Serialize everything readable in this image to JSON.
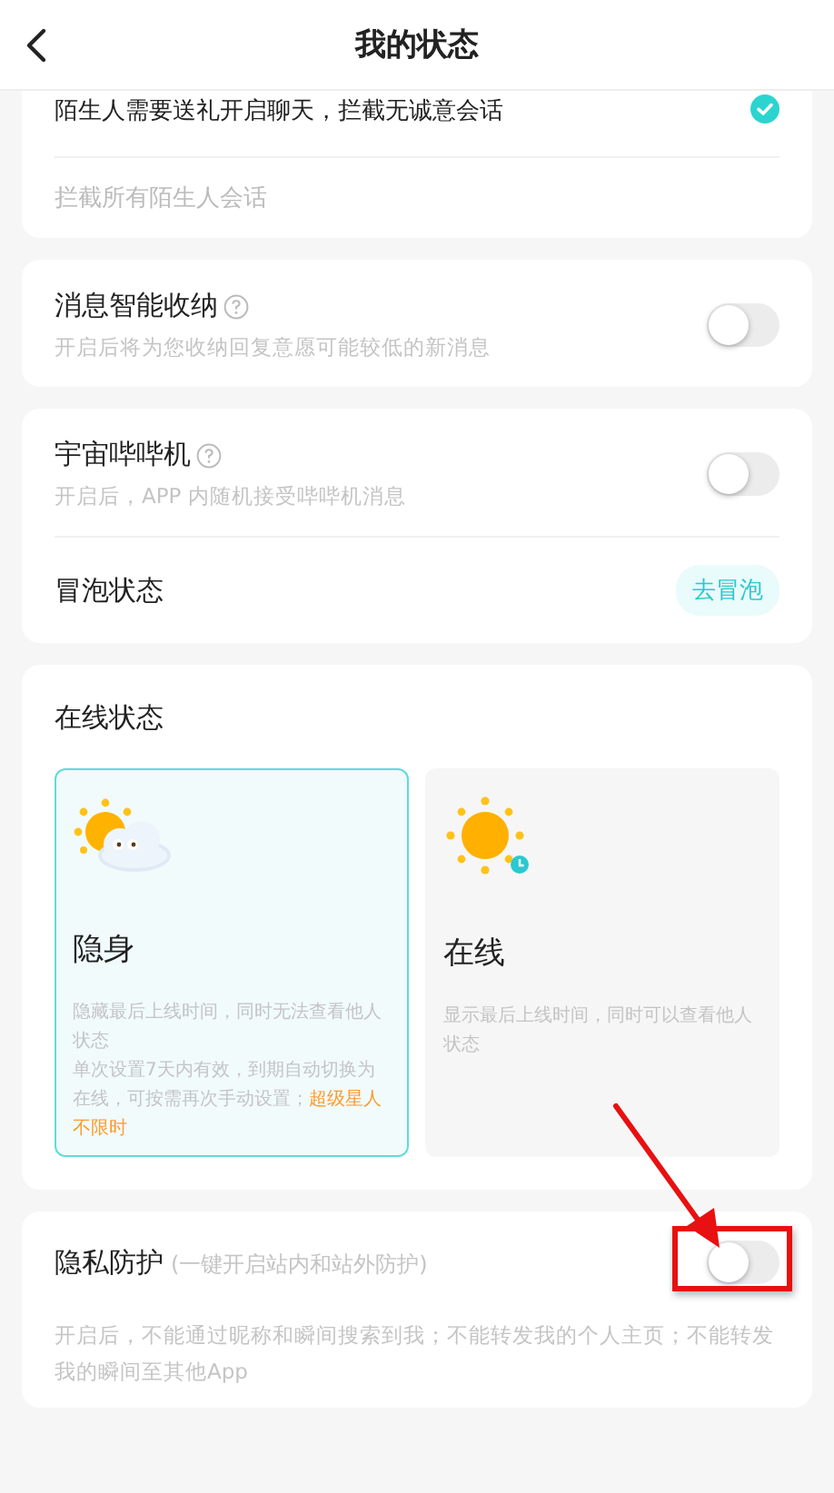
{
  "header": {
    "title": "我的状态"
  },
  "stranger_options": [
    {
      "label": "陌生人需要送礼开启聊天，拦截无诚意会话",
      "selected": true
    },
    {
      "label": "拦截所有陌生人会话",
      "selected": false
    }
  ],
  "smart_inbox": {
    "title": "消息智能收纳",
    "description": "开启后将为您收纳回复意愿可能较低的新消息",
    "on": false
  },
  "cosmos_beeper": {
    "title": "宇宙哔哔机",
    "description": "开启后，APP 内随机接受哔哔机消息",
    "on": false
  },
  "bubble": {
    "label": "冒泡状态",
    "button": "去冒泡"
  },
  "online_status": {
    "title": "在线状态",
    "options": [
      {
        "kind": "hidden",
        "label": "隐身",
        "description": [
          "隐藏最后上线时间，同时无法查看他人状态",
          "单次设置7天内有效，到期自动切换为在线，可按需再次手动设置；**超级星人不限时**"
        ],
        "selected": true
      },
      {
        "kind": "online",
        "label": "在线",
        "description": [
          "显示最后上线时间，同时可以查看他人状态"
        ],
        "selected": false
      }
    ]
  },
  "privacy": {
    "title": "隐私防护",
    "subtitle": "(一键开启站内和站外防护)",
    "description": "开启后，不能通过昵称和瞬间搜索到我；不能转发我的个人主页；不能转发我的瞬间至其他App",
    "on": false,
    "highlighted": true
  }
}
